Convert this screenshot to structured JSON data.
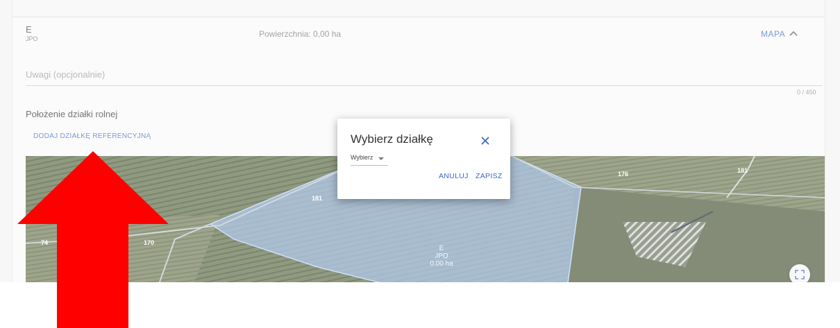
{
  "parcel": {
    "letter": "E",
    "code": "JPO",
    "area": "Powierzchnia: 0,00 ha",
    "map_label": "MAPA"
  },
  "notes": {
    "placeholder": "Uwagi (opcjonalnie)",
    "counter": "0 / 450"
  },
  "location": {
    "title": "Położenie działki rolnej",
    "add_reference": "DODAJ DZIAŁKĘ REFERENCYJNĄ"
  },
  "map": {
    "parcel_label_letter": "E",
    "parcel_label_code": "JPO",
    "parcel_label_area": "0.00 ha",
    "numbers": [
      "181",
      "176",
      "181",
      "74",
      "170"
    ],
    "fullscreen_icon": "fullscreen-icon"
  },
  "dialog": {
    "title": "Wybierz działkę",
    "select_value": "Wybierz",
    "cancel": "ANULUJ",
    "save": "ZAPISZ"
  },
  "colors": {
    "accent": "#3a66c4",
    "arrow": "#ff0000",
    "parcel_fill": "#8fb3e8"
  }
}
